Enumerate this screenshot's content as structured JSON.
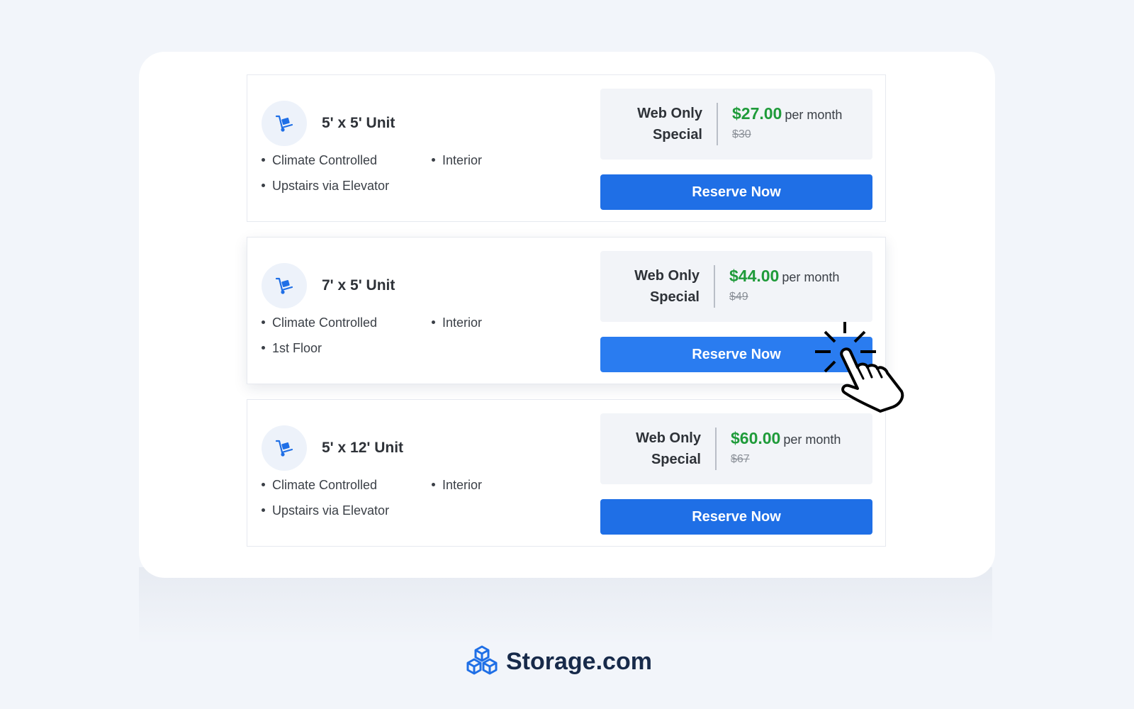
{
  "colors": {
    "accent": "#1f6fe6",
    "price_green": "#1f9b3a",
    "brand_navy": "#172a4a"
  },
  "units": [
    {
      "icon": "hand-truck-icon",
      "title": "5' x 5' Unit",
      "features": [
        "Climate Controlled",
        "Interior",
        "Upstairs via Elevator"
      ],
      "special_label_1": "Web Only",
      "special_label_2": "Special",
      "price": "$27.00",
      "per": "per month",
      "old_price": "$30",
      "button": "Reserve Now"
    },
    {
      "icon": "hand-truck-icon",
      "title": "7' x 5' Unit",
      "features": [
        "Climate Controlled",
        "Interior",
        "1st Floor"
      ],
      "special_label_1": "Web Only",
      "special_label_2": "Special",
      "price": "$44.00",
      "per": "per month",
      "old_price": "$49",
      "button": "Reserve Now"
    },
    {
      "icon": "hand-truck-icon",
      "title": "5' x 12' Unit",
      "features": [
        "Climate Controlled",
        "Interior",
        "Upstairs via Elevator"
      ],
      "special_label_1": "Web Only",
      "special_label_2": "Special",
      "price": "$60.00",
      "per": "per month",
      "old_price": "$67",
      "button": "Reserve Now"
    }
  ],
  "brand": {
    "name": "Storage.com",
    "logo_icon": "stacked-cubes-logo-icon"
  }
}
